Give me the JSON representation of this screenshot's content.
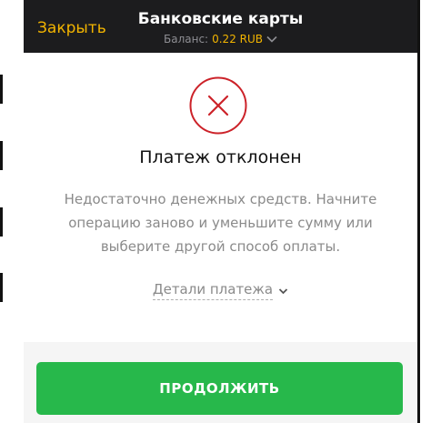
{
  "colors": {
    "header_bg": "#1c1c1e",
    "accent": "#f2b400",
    "error": "#cc2229",
    "button": "#27b84b",
    "muted_text": "#8a8a8a"
  },
  "header": {
    "close_label": "Закрыть",
    "title": "Банковские карты",
    "balance_label": "Баланс:",
    "balance_value": "0.22 RUB",
    "balance_icon": "chevron-down-icon"
  },
  "status": {
    "icon": "error-circle-x-icon",
    "title": "Платеж отклонен",
    "message": "Недостаточно денежных средств. Начните операцию заново и уменьшите сумму или выберите другой способ оплаты."
  },
  "details": {
    "label": "Детали платежа",
    "icon": "chevron-down-icon"
  },
  "footer": {
    "continue_label": "ПРОДОЛЖИТЬ"
  }
}
